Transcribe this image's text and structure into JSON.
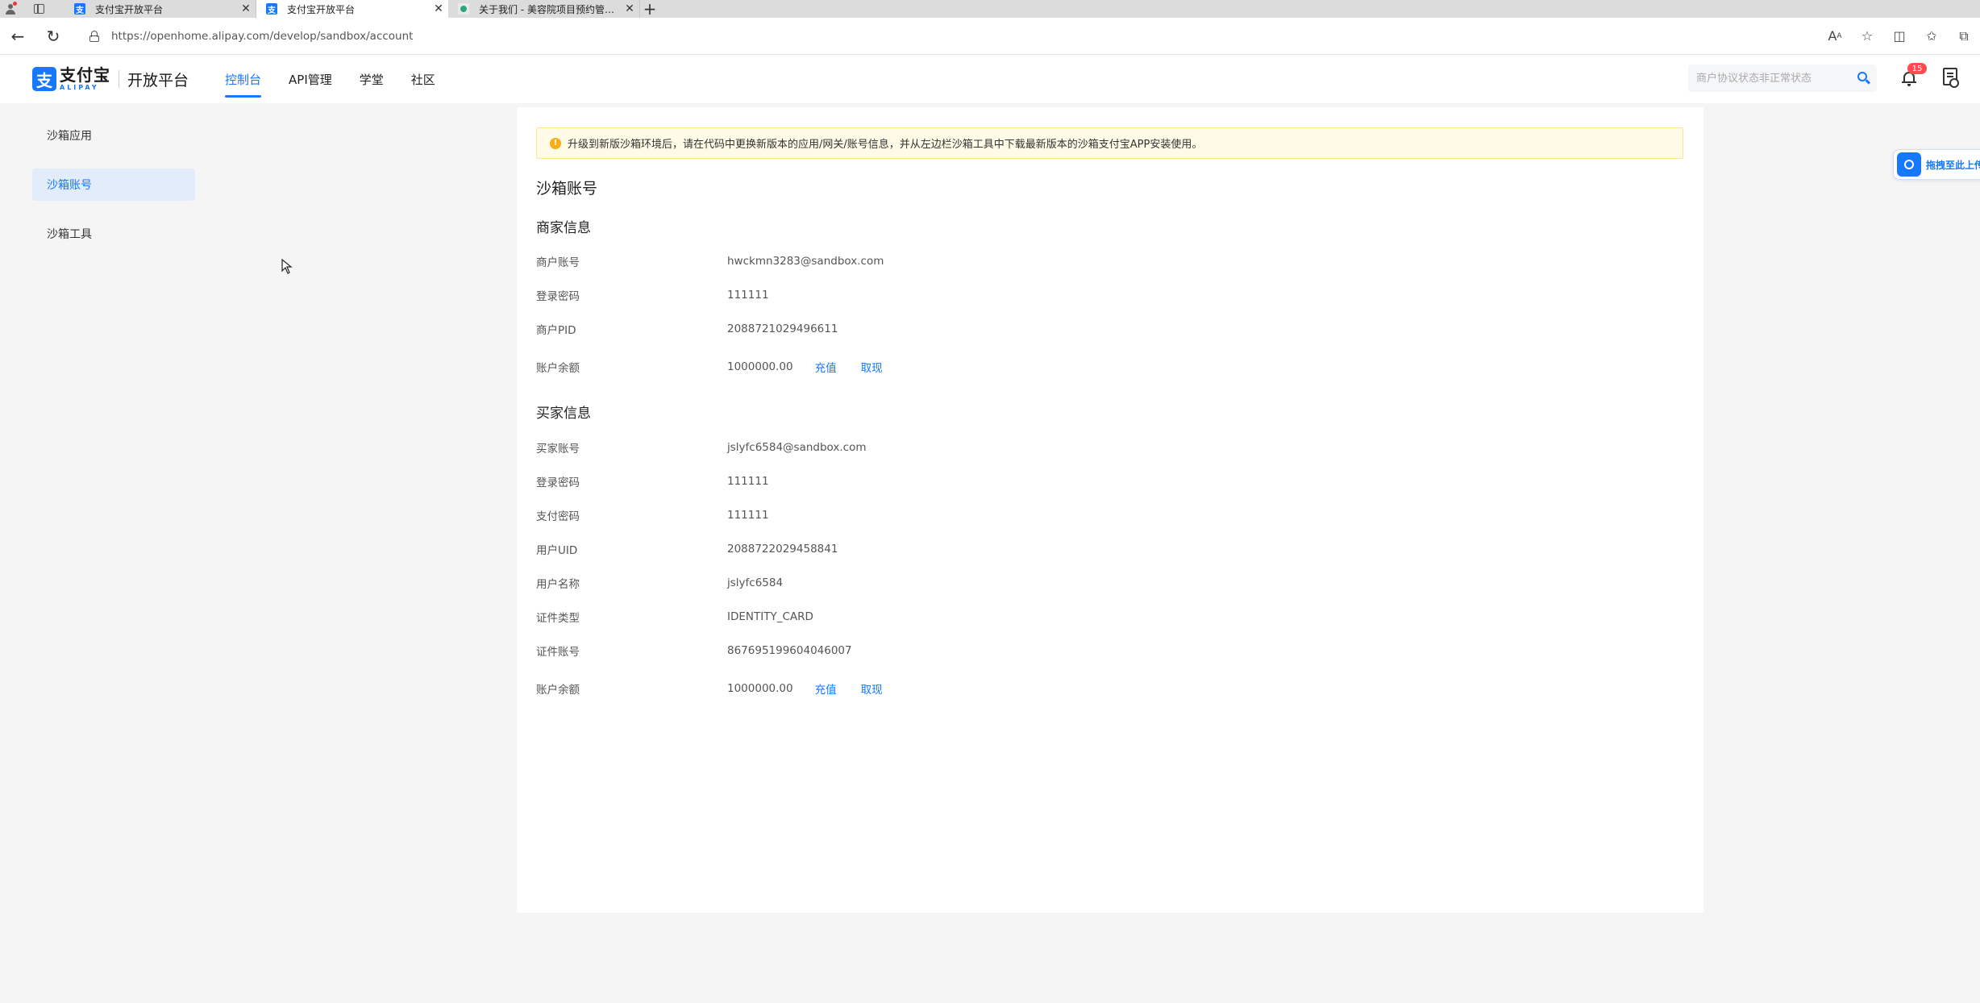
{
  "browser": {
    "tabs": [
      {
        "title": "支付宝开放平台",
        "active": false,
        "favicon": "alipay-icon"
      },
      {
        "title": "支付宝开放平台",
        "active": true,
        "favicon": "alipay-icon"
      },
      {
        "title": "关于我们 - 美容院项目预约管理系统",
        "active": false,
        "favicon": "app-icon"
      }
    ],
    "url": "https://openhome.alipay.com/develop/sandbox/account"
  },
  "header": {
    "logo_text": "支付宝",
    "logo_sub": "ALIPAY",
    "platform_name": "开放平台",
    "nav": [
      "控制台",
      "API管理",
      "学堂",
      "社区"
    ],
    "active_nav": "控制台",
    "search_placeholder": "商户协议状态非正常状态",
    "notification_count": "15"
  },
  "sidebar": {
    "items": [
      "沙箱应用",
      "沙箱账号",
      "沙箱工具"
    ],
    "active": "沙箱账号"
  },
  "main": {
    "notice": "升级到新版沙箱环境后，请在代码中更换新版本的应用/网关/账号信息，并从左边栏沙箱工具中下载最新版本的沙箱支付宝APP安装使用。",
    "page_title": "沙箱账号",
    "merchant": {
      "title": "商家信息",
      "rows": [
        {
          "label": "商户账号",
          "value": "hwckmn3283@sandbox.com"
        },
        {
          "label": "登录密码",
          "value": "111111"
        },
        {
          "label": "商户PID",
          "value": "2088721029496611"
        },
        {
          "label": "账户余额",
          "value": "1000000.00",
          "actions": [
            "充值",
            "取现"
          ]
        }
      ]
    },
    "buyer": {
      "title": "买家信息",
      "rows": [
        {
          "label": "买家账号",
          "value": "jslyfc6584@sandbox.com"
        },
        {
          "label": "登录密码",
          "value": "111111"
        },
        {
          "label": "支付密码",
          "value": "111111"
        },
        {
          "label": "用户UID",
          "value": "2088722029458841"
        },
        {
          "label": "用户名称",
          "value": "jslyfc6584"
        },
        {
          "label": "证件类型",
          "value": "IDENTITY_CARD"
        },
        {
          "label": "证件账号",
          "value": "867695199604046007"
        },
        {
          "label": "账户余额",
          "value": "1000000.00",
          "actions": [
            "充值",
            "取现"
          ]
        }
      ]
    }
  },
  "float_widget": {
    "label": "拖拽至此上传"
  },
  "colors": {
    "accent": "#1677ff",
    "notice_bg": "#fffbe6",
    "warn": "#faad14",
    "badge": "#ff4d4f"
  }
}
